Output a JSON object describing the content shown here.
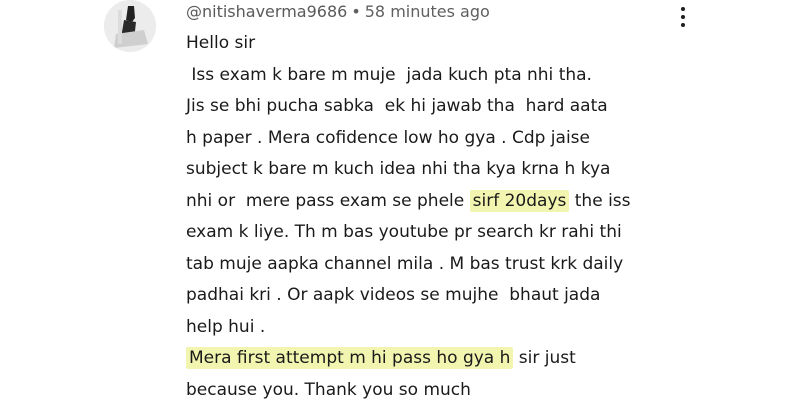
{
  "comment": {
    "author": "@nitishaverma9686",
    "separator": "•",
    "time": "58 minutes ago",
    "menu_icon": "more-vert-icon",
    "highlight_color": "#f1f5b0",
    "lines": [
      [
        "Hello sir"
      ],
      [
        " Iss exam k bare m muje  jada kuch pta nhi tha."
      ],
      [
        "Jis se bhi pucha sabka  ek hi jawab tha  hard aata"
      ],
      [
        "h paper . Mera cofidence low ho gya . Cdp jaise"
      ],
      [
        "subject k bare m kuch idea nhi tha kya krna h kya"
      ],
      [
        "nhi or  mere pass exam se phele ",
        "sirf 20days",
        " the iss"
      ],
      [
        "exam k liye. Th m bas youtube pr search kr rahi thi"
      ],
      [
        "tab muje aapka channel mila . M bas trust krk daily"
      ],
      [
        "padhai kri . Or aapk videos se mujhe  bhaut jada"
      ],
      [
        "help hui ."
      ],
      [
        "Mera first attempt m hi pass ho gya h",
        " sir just"
      ],
      [
        "because you. Thank you so much"
      ]
    ]
  }
}
